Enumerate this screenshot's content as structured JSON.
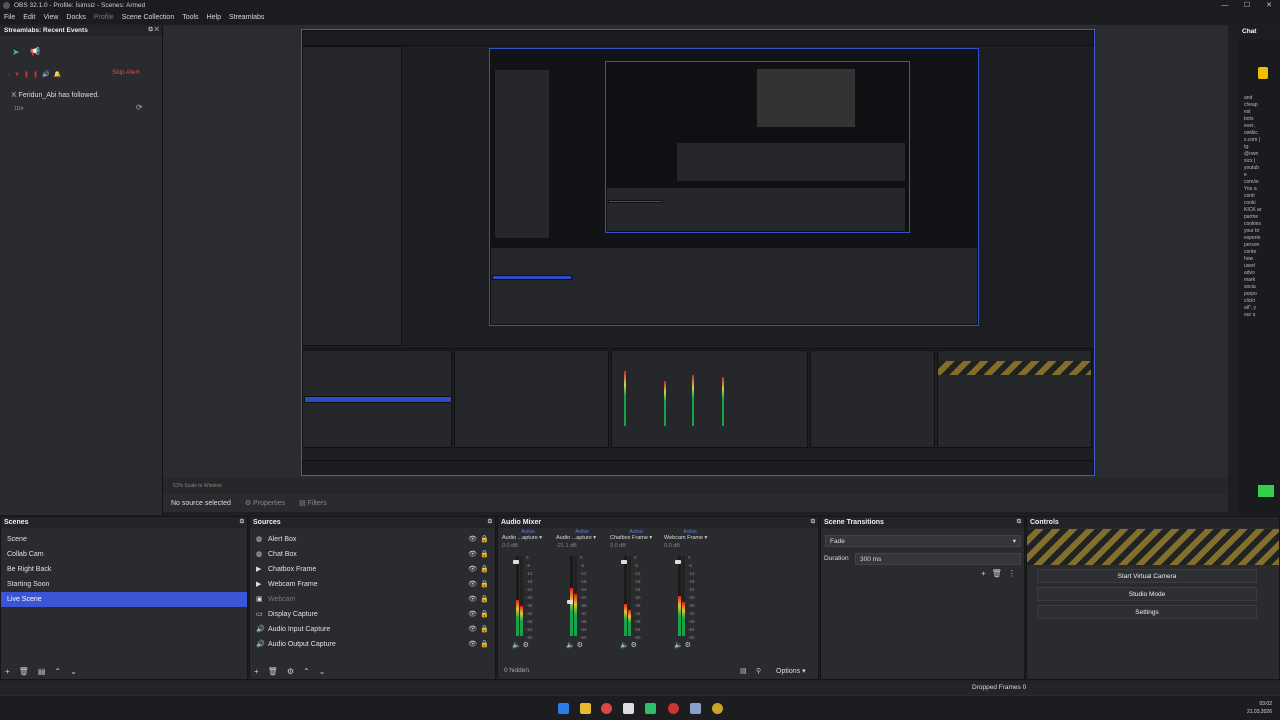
{
  "window": {
    "title": "OBS 32.1.0 - Profile: İsimsiz - Scenes: Armed"
  },
  "menu": [
    "File",
    "Edit",
    "View",
    "Docks",
    "Profile",
    "Scene Collection",
    "Tools",
    "Help",
    "Streamlabs"
  ],
  "events": {
    "title": "Streamlabs: Recent Events",
    "skip": "Skip Alert",
    "item_user": "Feridun_Abi",
    "item_text": "has followed.",
    "item_time": "11hr"
  },
  "chat": {
    "title": "Chat",
    "lines": [
      "and",
      "cheap",
      "est",
      "bots",
      "ever,",
      "owtkic",
      "x.com |",
      "tg:",
      "@own",
      "xicx |",
      "youtub",
      "e",
      "com/w",
      "",
      "You a",
      "conti",
      "cooki",
      "",
      "KICK ar",
      "partne",
      "cookies",
      "your br",
      "experie",
      "person",
      "conte",
      "how",
      "used",
      "advo",
      "mark",
      "socia",
      "purpo",
      "clicki",
      "all\", y",
      "our u"
    ]
  },
  "preview": {
    "status": "61%   Scale to Window"
  },
  "source_bar": {
    "no_source": "No source selected",
    "properties": "Properties",
    "filters": "Filters"
  },
  "scenes": {
    "title": "Scenes",
    "items": [
      "Scene",
      "Collab Cam",
      "Be Right Back",
      "Starting Soon",
      "Live Scene"
    ],
    "selected_index": 4
  },
  "sources": {
    "title": "Sources",
    "items": [
      {
        "name": "Alert Box",
        "icon": "globe-icon"
      },
      {
        "name": "Chat Box",
        "icon": "globe-icon"
      },
      {
        "name": "Chatbox Frame",
        "icon": "play-icon"
      },
      {
        "name": "Webcam Frame",
        "icon": "play-icon"
      },
      {
        "name": "Webcam",
        "icon": "camera-icon",
        "hidden": true
      },
      {
        "name": "Display Capture",
        "icon": "monitor-icon"
      },
      {
        "name": "Audio Input Capture",
        "icon": "speaker-icon"
      },
      {
        "name": "Audio Output Capture",
        "icon": "speaker-icon"
      }
    ]
  },
  "mixer": {
    "title": "Audio Mixer",
    "hidden_label": "0 hidden",
    "options": "Options",
    "scale": [
      "0",
      "-6",
      "-12",
      "-18",
      "-24",
      "-30",
      "-36",
      "-42",
      "-48",
      "-54",
      "-60"
    ],
    "channels": [
      {
        "name": "Audio ...apture",
        "status": "Active",
        "db": "0.0 dB",
        "level": 0.45,
        "fader": 0.95
      },
      {
        "name": "Audio ...apture",
        "status": "Active",
        "db": "-21.1 dB",
        "level": 0.6,
        "fader": 0.45
      },
      {
        "name": "Chatbox Frame",
        "status": "Active",
        "db": "0.0 dB",
        "level": 0.4,
        "fader": 0.95
      },
      {
        "name": "Webcam Frame",
        "status": "Active",
        "db": "0.0 dB",
        "level": 0.5,
        "fader": 0.95
      }
    ]
  },
  "transitions": {
    "title": "Scene Transitions",
    "selected": "Fade",
    "duration_label": "Duration",
    "duration_value": "300 ms"
  },
  "controls": {
    "title": "Controls",
    "buttons": [
      "Start Virtual Camera",
      "Studio Mode",
      "Settings"
    ]
  },
  "status": {
    "dropped": "Dropped Frames 0"
  },
  "taskbar": {
    "time": "03:02",
    "date": "21.03.2026"
  }
}
